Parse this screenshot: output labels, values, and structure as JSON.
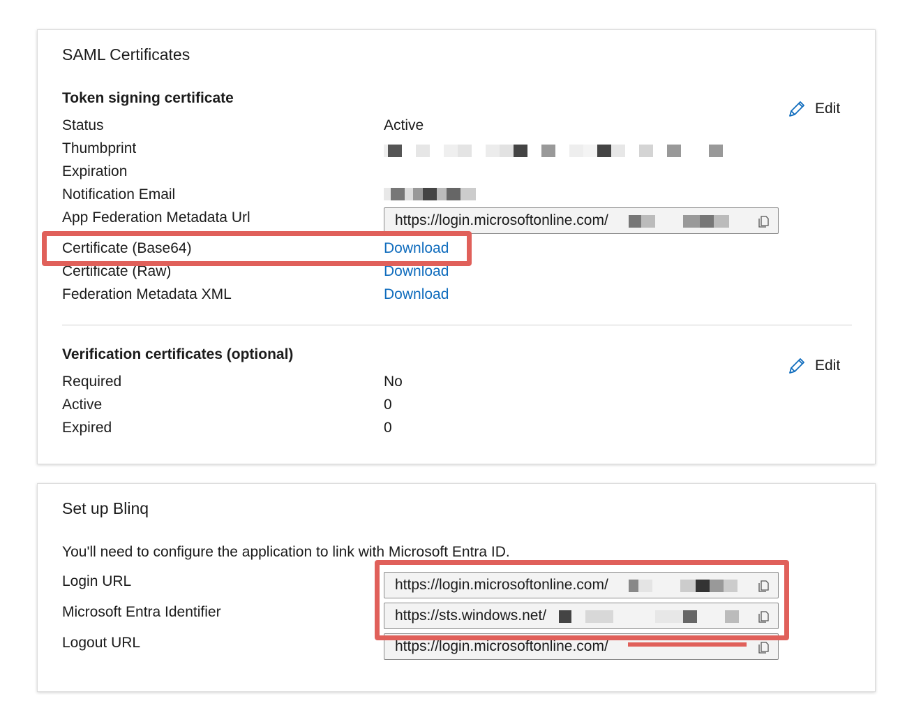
{
  "saml": {
    "title": "SAML Certificates",
    "token_section_title": "Token signing certificate",
    "edit_label": "Edit",
    "rows": {
      "status_label": "Status",
      "status_value": "Active",
      "thumbprint_label": "Thumbprint",
      "expiration_label": "Expiration",
      "notification_label": "Notification Email",
      "metadata_url_label": "App Federation Metadata Url",
      "metadata_url_value": "https://login.microsoftonline.com/",
      "cert_base64_label": "Certificate (Base64)",
      "cert_raw_label": "Certificate (Raw)",
      "fed_xml_label": "Federation Metadata XML",
      "download_label": "Download"
    },
    "verification_title": "Verification certificates (optional)",
    "verification_rows": {
      "required_label": "Required",
      "required_value": "No",
      "active_label": "Active",
      "active_value": "0",
      "expired_label": "Expired",
      "expired_value": "0"
    }
  },
  "setup": {
    "title": "Set up Blinq",
    "intro": "You'll need to configure the application to link with Microsoft Entra ID.",
    "login_url_label": "Login URL",
    "login_url_value": "https://login.microsoftonline.com/",
    "entra_id_label": "Microsoft Entra Identifier",
    "entra_id_value": "https://sts.windows.net/",
    "logout_url_label": "Logout URL",
    "logout_url_value": "https://login.microsoftonline.com/"
  },
  "colors": {
    "link": "#0f6cbd",
    "highlight": "#e0605a",
    "field_bg": "#f3f3f3"
  },
  "icons": [
    "pencil-icon",
    "copy-icon"
  ]
}
